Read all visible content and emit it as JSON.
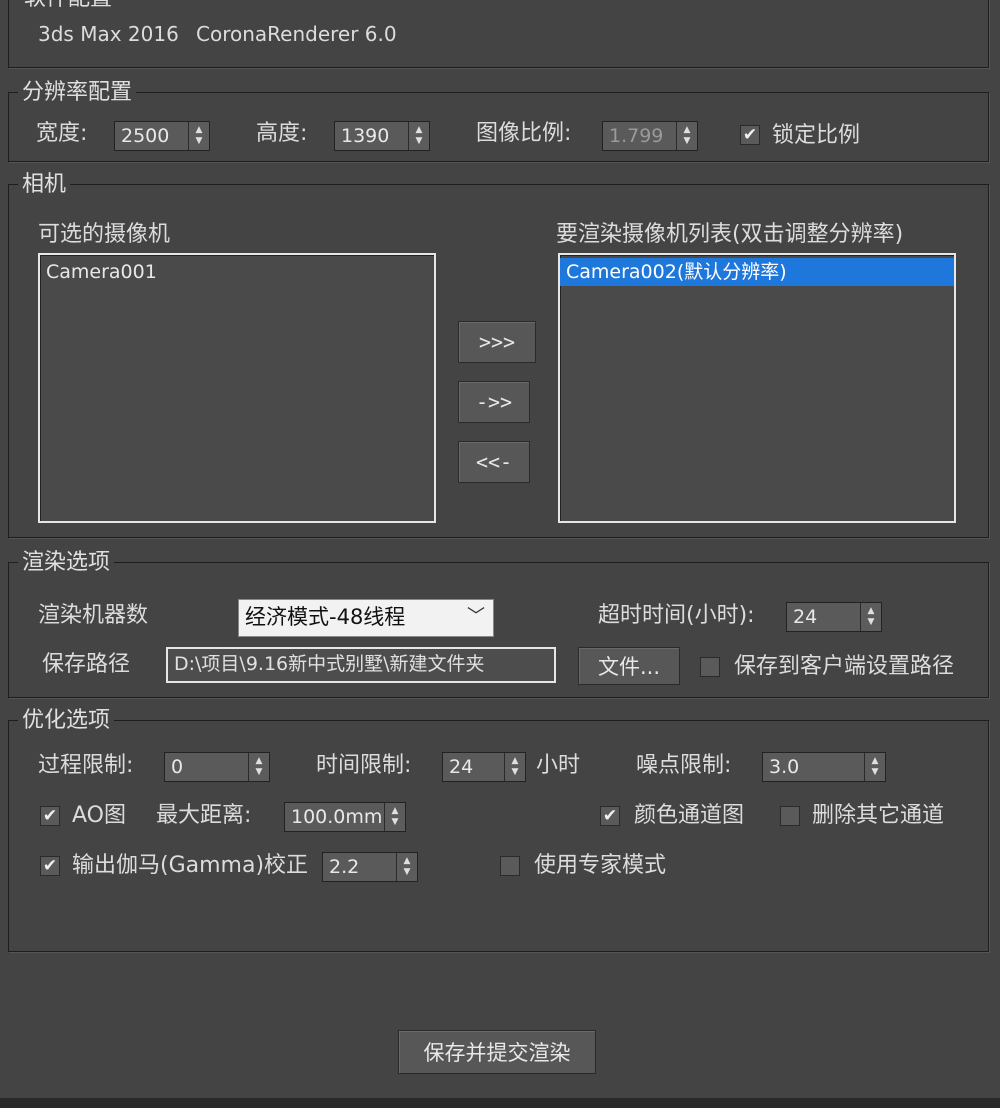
{
  "software": {
    "legend": "软件配置",
    "max_version": "3ds Max 2016",
    "renderer_version": "CoronaRenderer 6.0"
  },
  "resolution": {
    "legend": "分辨率配置",
    "width_label": "宽度:",
    "width_value": "2500",
    "height_label": "高度:",
    "height_value": "1390",
    "ratio_label": "图像比例:",
    "ratio_value": "1.799",
    "lock_label": "锁定比例",
    "lock_checked": "✔"
  },
  "camera": {
    "legend": "相机",
    "available_label": "可选的摄像机",
    "available_items": [
      "Camera001"
    ],
    "render_label": "要渲染摄像机列表(双击调整分辨率)",
    "render_items": [
      "Camera002(默认分辨率)"
    ],
    "btn_add_all": ">>>",
    "btn_add": "->>",
    "btn_remove": "<<-"
  },
  "render_options": {
    "legend": "渲染选项",
    "machines_label": "渲染机器数",
    "machines_value": "经济模式-48线程",
    "timeout_label": "超时时间(小时):",
    "timeout_value": "24",
    "save_path_label": "保存路径",
    "save_path_value": "D:\\项目\\9.16新中式别墅\\新建文件夹",
    "file_button": "文件...",
    "save_client_label": "保存到客户端设置路径"
  },
  "optimize": {
    "legend": "优化选项",
    "pass_limit_label": "过程限制:",
    "pass_limit_value": "0",
    "time_limit_label": "时间限制:",
    "time_limit_value": "24",
    "time_unit": "小时",
    "noise_limit_label": "噪点限制:",
    "noise_limit_value": "3.0",
    "ao_label": "AO图",
    "ao_checked": "✔",
    "max_dist_label": "最大距离:",
    "max_dist_value": "100.0mm",
    "color_channel_label": "颜色通道图",
    "color_channel_checked": "✔",
    "delete_channels_label": "删除其它通道",
    "gamma_label": "输出伽马(Gamma)校正",
    "gamma_checked": "✔",
    "gamma_value": "2.2",
    "expert_label": "使用专家模式"
  },
  "submit_button": "保存并提交渲染"
}
